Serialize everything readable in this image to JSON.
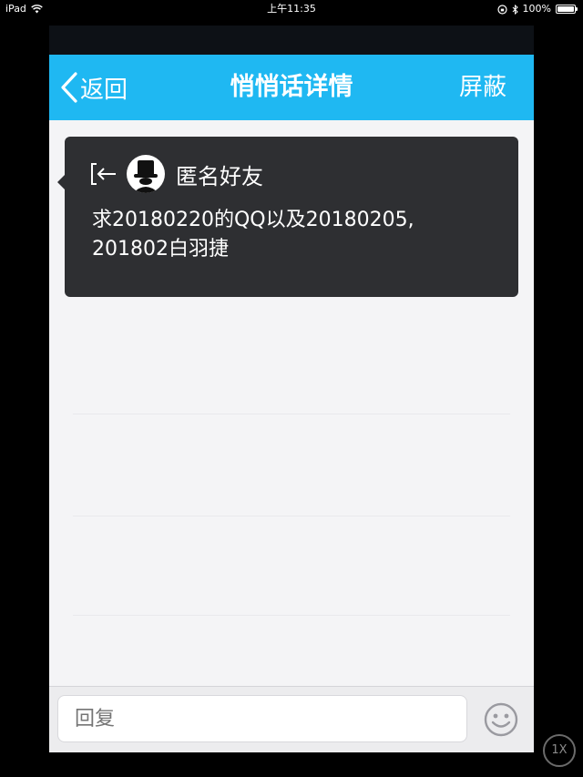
{
  "status_bar": {
    "device": "iPad",
    "time": "上午11:35",
    "battery": "100%",
    "battery_level": 1.0
  },
  "navbar": {
    "back_label": "返回",
    "title": "悄悄话详情",
    "right_label": "屏蔽"
  },
  "message": {
    "sender": "匿名好友",
    "text_line1": "求20180220的QQ以及20180205,",
    "text_line2": "201802白羽捷"
  },
  "reply": {
    "placeholder": "回复"
  },
  "zoom_badge": "1X",
  "colors": {
    "navbar": "#1fb8f2",
    "card": "#2e2f32",
    "background": "#f4f4f6"
  }
}
